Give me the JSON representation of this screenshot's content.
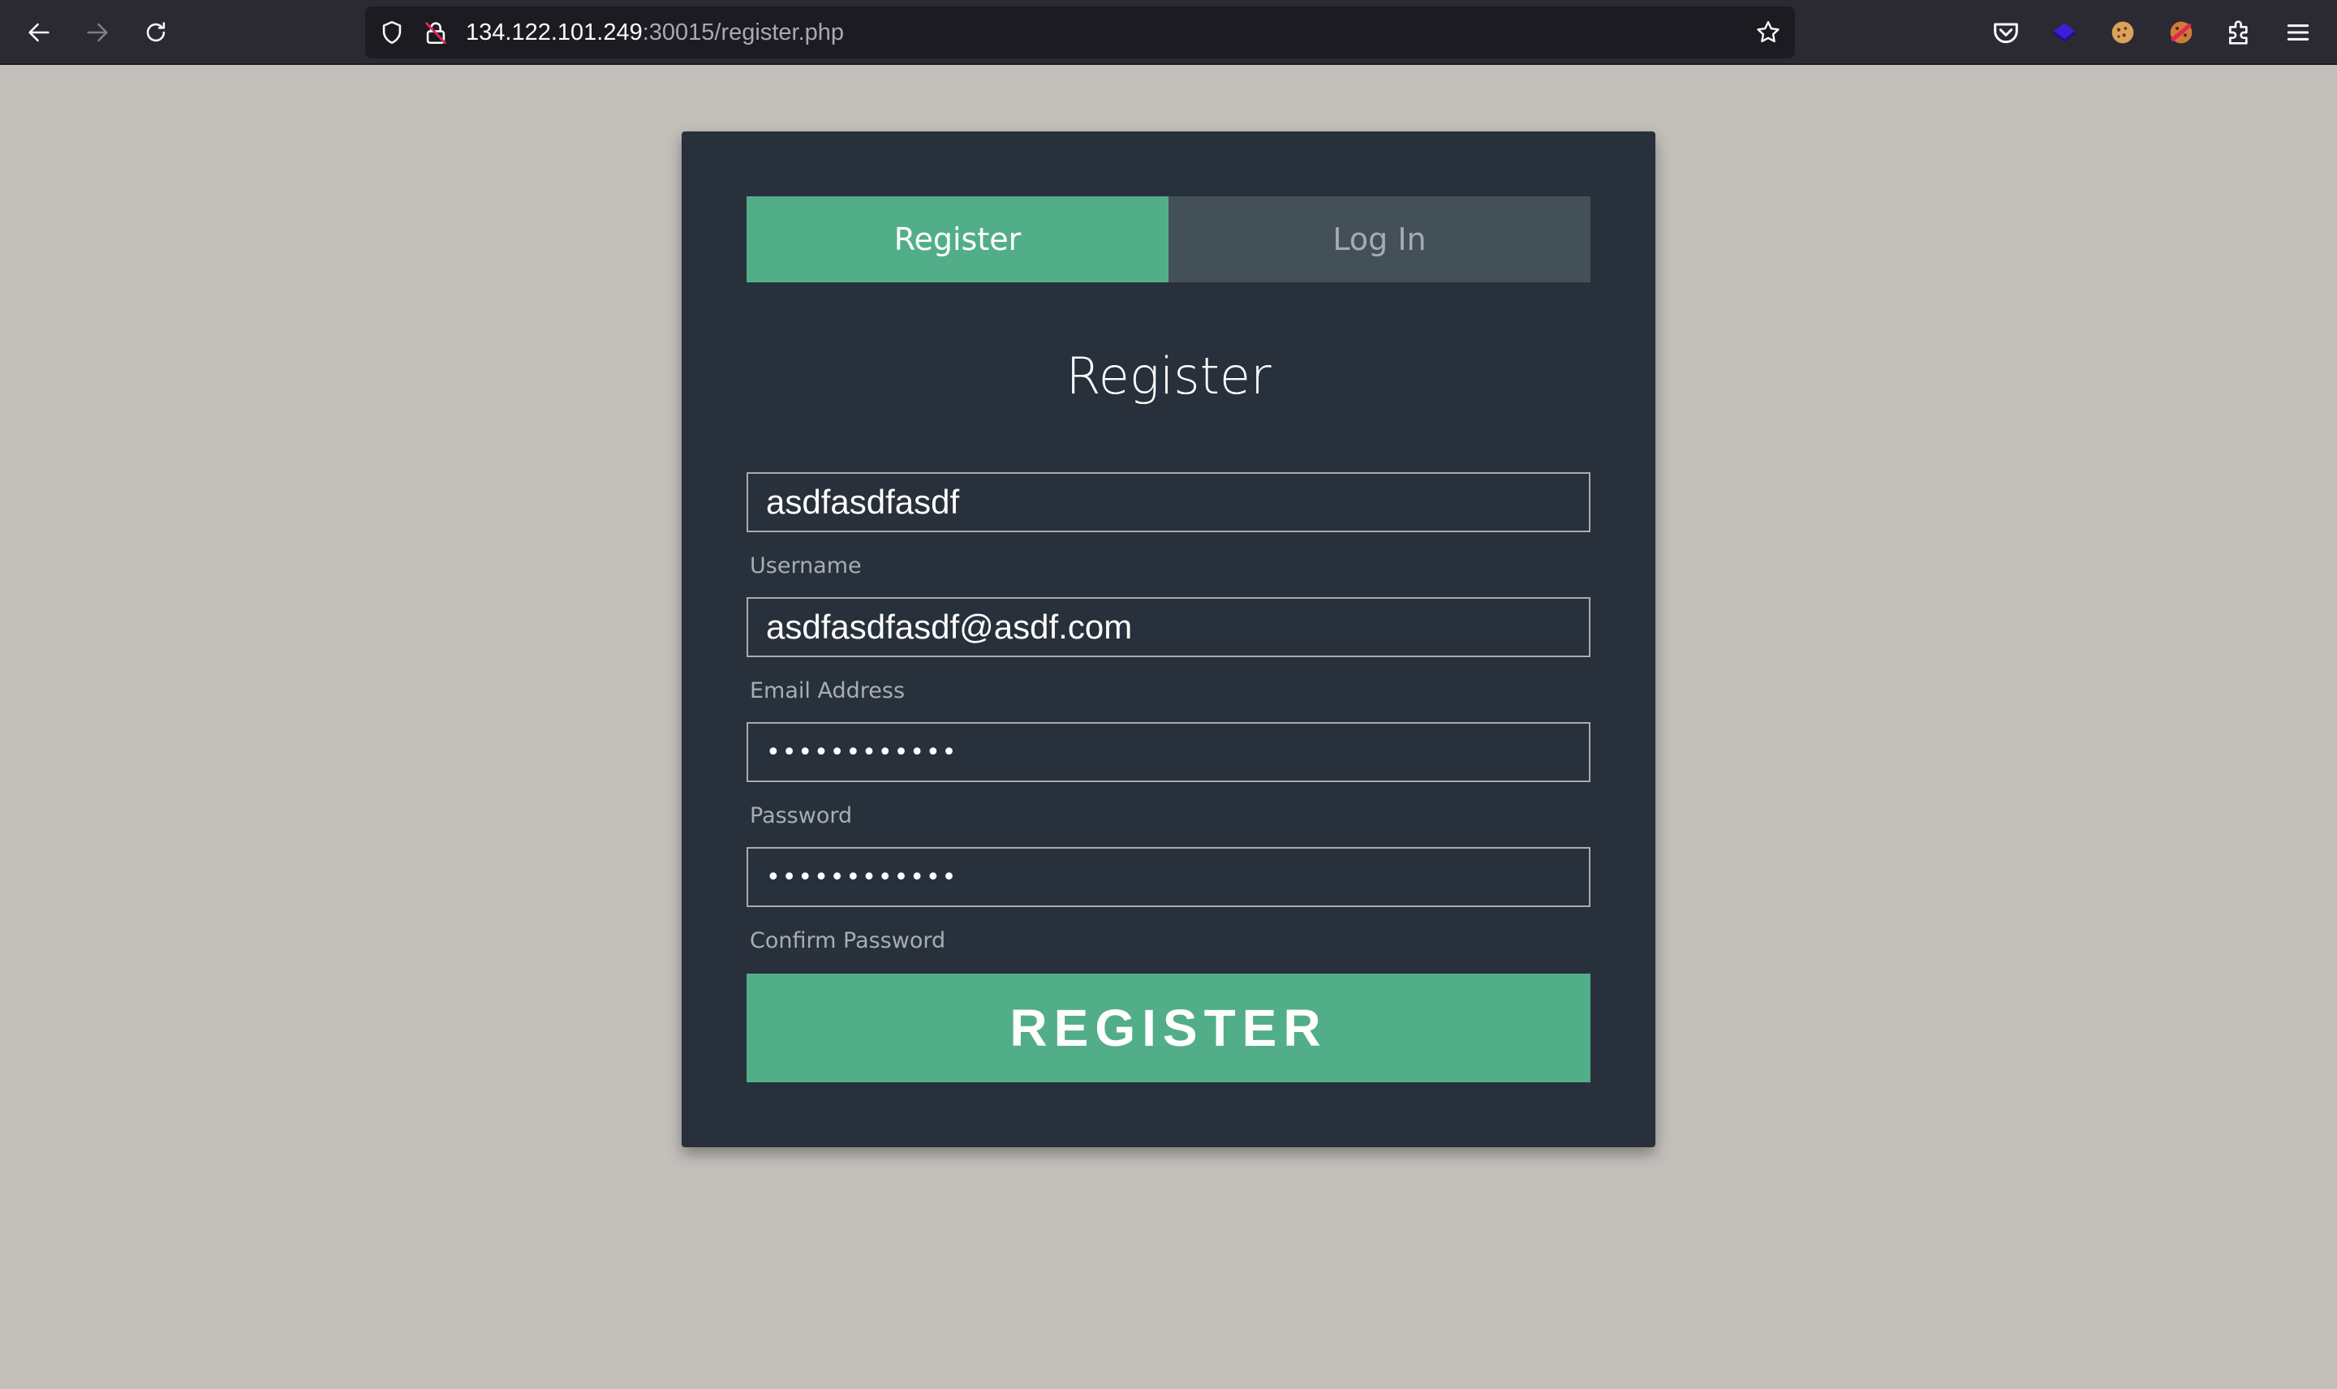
{
  "browser": {
    "url_host": "134.122.101.249",
    "url_rest": ":30015/register.php",
    "icons": {
      "back": "back-arrow-icon",
      "forward": "forward-arrow-icon",
      "reload": "reload-icon",
      "shield": "shield-icon",
      "insecure": "insecure-lock-icon",
      "bookmark": "star-icon",
      "pocket": "pocket-icon",
      "ext1": "gem-extension-icon",
      "ext2": "cookie-extension-icon",
      "ext3": "cookie-editor-extension-icon",
      "extensions": "puzzle-icon",
      "menu": "hamburger-menu-icon"
    }
  },
  "tabs": {
    "register": "Register",
    "login": "Log In"
  },
  "form": {
    "title": "Register",
    "fields": {
      "username": {
        "value": "asdfasdfasdf",
        "label": "Username"
      },
      "email": {
        "value": "asdfasdfasdf@asdf.com",
        "label": "Email Address"
      },
      "password": {
        "value": "••••••••••••",
        "label": "Password"
      },
      "confirm": {
        "value": "••••••••••••",
        "label": "Confirm Password"
      }
    },
    "submit_label": "REGISTER"
  },
  "colors": {
    "page_bg": "#c3bfbb",
    "card_bg": "#28303b",
    "accent": "#52ae89",
    "tab_inactive": "#435058"
  }
}
